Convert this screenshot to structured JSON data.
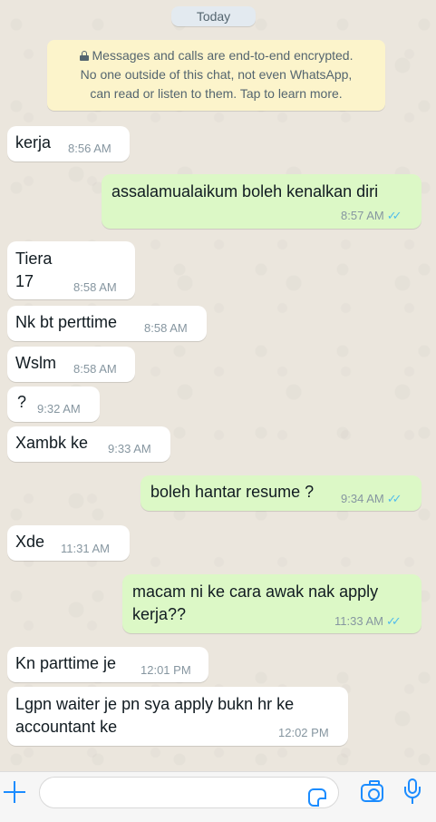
{
  "date_label": "Today",
  "encryption": {
    "line1": "Messages and calls are end-to-end encrypted.",
    "line2": "No one outside of this chat, not even WhatsApp,",
    "line3": "can read or listen to them. Tap to learn more."
  },
  "messages": [
    {
      "dir": "in",
      "lines": [
        "kerja"
      ],
      "time": "8:56 AM"
    },
    {
      "dir": "out",
      "lines": [
        "assalamualaikum boleh kenalkan diri"
      ],
      "time": "8:57 AM",
      "status": "read"
    },
    {
      "dir": "in",
      "lines": [
        "Tiera",
        "17"
      ],
      "time": "8:58 AM"
    },
    {
      "dir": "in",
      "lines": [
        "Nk bt perttime"
      ],
      "time": "8:58 AM"
    },
    {
      "dir": "in",
      "lines": [
        "Wslm"
      ],
      "time": "8:58 AM"
    },
    {
      "dir": "in",
      "lines": [
        "?"
      ],
      "time": "9:32 AM"
    },
    {
      "dir": "in",
      "lines": [
        "Xambk ke"
      ],
      "time": "9:33 AM"
    },
    {
      "dir": "out",
      "lines": [
        "boleh hantar resume ?"
      ],
      "time": "9:34 AM",
      "status": "read"
    },
    {
      "dir": "in",
      "lines": [
        "Xde"
      ],
      "time": "11:31 AM"
    },
    {
      "dir": "out",
      "lines": [
        "macam ni ke cara awak nak apply",
        "kerja??"
      ],
      "time": "11:33 AM",
      "status": "read"
    },
    {
      "dir": "in",
      "lines": [
        "Kn parttime je"
      ],
      "time": "12:01 PM"
    },
    {
      "dir": "in",
      "lines": [
        "Lgpn waiter je pn sya apply bukn hr ke",
        "accountant ke"
      ],
      "time": "12:02 PM"
    }
  ],
  "input_bar": {
    "message_value": "",
    "icons": [
      "plus-icon",
      "sticker-icon",
      "camera-icon",
      "microphone-icon"
    ]
  },
  "colors": {
    "incoming_bubble": "#ffffff",
    "outgoing_bubble": "#dcf8c6",
    "read_ticks": "#53bdeb",
    "accent": "#1b8cff"
  }
}
